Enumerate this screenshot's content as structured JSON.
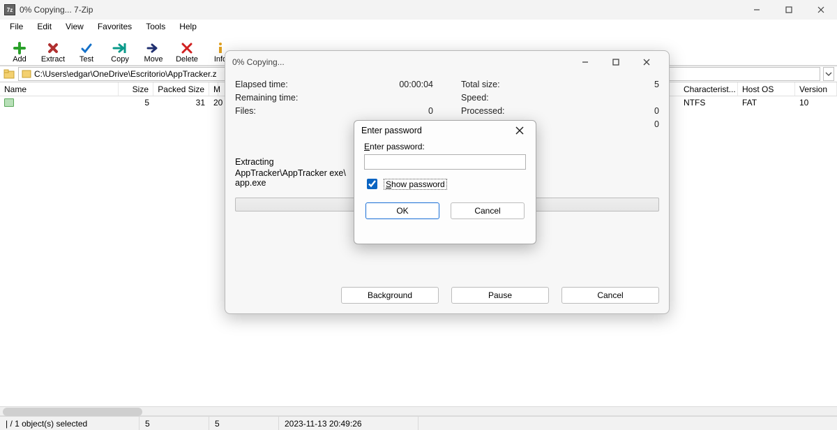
{
  "window": {
    "title": "0% Copying... 7-Zip",
    "app_icon_label": "7z"
  },
  "menubar": [
    "File",
    "Edit",
    "View",
    "Favorites",
    "Tools",
    "Help"
  ],
  "toolbar": [
    {
      "id": "add",
      "label": "Add"
    },
    {
      "id": "extract",
      "label": "Extract"
    },
    {
      "id": "test",
      "label": "Test"
    },
    {
      "id": "copy",
      "label": "Copy"
    },
    {
      "id": "move",
      "label": "Move"
    },
    {
      "id": "delete",
      "label": "Delete"
    },
    {
      "id": "info",
      "label": "Info"
    }
  ],
  "address": {
    "path": "C:\\Users\\edgar\\OneDrive\\Escritorio\\AppTracker.z"
  },
  "columns": {
    "name": "Name",
    "size": "Size",
    "packed_size": "Packed Size",
    "modified_short": "M",
    "characteristics": "Characterist...",
    "host_os": "Host OS",
    "version": "Version"
  },
  "rows": [
    {
      "name": "",
      "size": "5",
      "packed_size": "31",
      "modified_short": "20",
      "characteristics": "NTFS",
      "host_os": "FAT",
      "version": "10"
    }
  ],
  "statusbar": {
    "selection": "| / 1 object(s) selected",
    "n1": "5",
    "n2": "5",
    "date": "2023-11-13 20:49:26"
  },
  "progress_dialog": {
    "title": "0% Copying...",
    "left": {
      "elapsed_label": "Elapsed time:",
      "elapsed_value": "00:00:04",
      "remaining_label": "Remaining time:",
      "remaining_value": "",
      "files_label": "Files:",
      "files_value": "0"
    },
    "right": {
      "total_label": "Total size:",
      "total_value": "5",
      "speed_label": "Speed:",
      "speed_value": "",
      "processed_label": "Processed:",
      "processed_value": "0",
      "blank_label": "",
      "blank_value": "0"
    },
    "section_label": "Extracting",
    "current_path": "AppTracker\\AppTracker exe\\\napp.exe",
    "buttons": {
      "background": "Background",
      "pause": "Pause",
      "cancel": "Cancel"
    }
  },
  "password_dialog": {
    "title": "Enter password",
    "field_label_prefix": "E",
    "field_label_rest": "nter password:",
    "show_prefix": "S",
    "show_rest": "how password",
    "show_checked": true,
    "ok": "OK",
    "cancel": "Cancel"
  }
}
